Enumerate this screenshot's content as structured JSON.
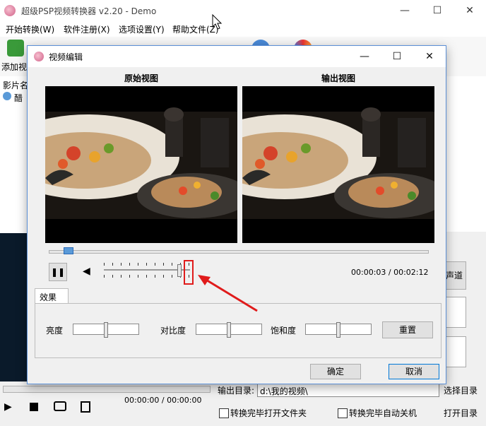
{
  "main_window": {
    "title": "超级PSP视频转换器 v2.20 - Demo",
    "menu": [
      "开始转换(W)",
      "软件注册(X)",
      "选项设置(Y)",
      "帮助文件(Z)"
    ],
    "toolbar_first_label": "添加视",
    "list_header": "影片名",
    "list_item": "醋",
    "right_button_label": "声道",
    "output_dir_label": "输出目录:",
    "output_dir_value": "d:\\我的视频\\",
    "select_dir_button": "选择目录",
    "time_readout": "00:00:00 / 00:00:00",
    "open_dir_button": "打开目录",
    "checkbox_open_folder": "转换完毕打开文件夹",
    "checkbox_shutdown": "转换完毕自动关机"
  },
  "dialog": {
    "title": "视频编辑",
    "original_view_label": "原始视图",
    "output_view_label": "输出视图",
    "time_display": "00:00:03 / 00:02:12",
    "playback_position": 0.04,
    "volume_level": 0.9,
    "effects_tab": "效果",
    "brightness_label": "亮度",
    "brightness_level": 0.5,
    "contrast_label": "对比度",
    "contrast_level": 0.5,
    "saturation_label": "饱和度",
    "saturation_level": 0.5,
    "reset_button": "重置",
    "ok_button": "确定",
    "cancel_button": "取消"
  },
  "colors": {
    "highlight_red": "#e01b1b",
    "dialog_border": "#5b8fd6",
    "focus_blue": "#0078d7"
  },
  "icons": [
    "app-icon",
    "pause-icon",
    "volume-icon",
    "stop-icon",
    "play-icon",
    "camera-icon"
  ]
}
